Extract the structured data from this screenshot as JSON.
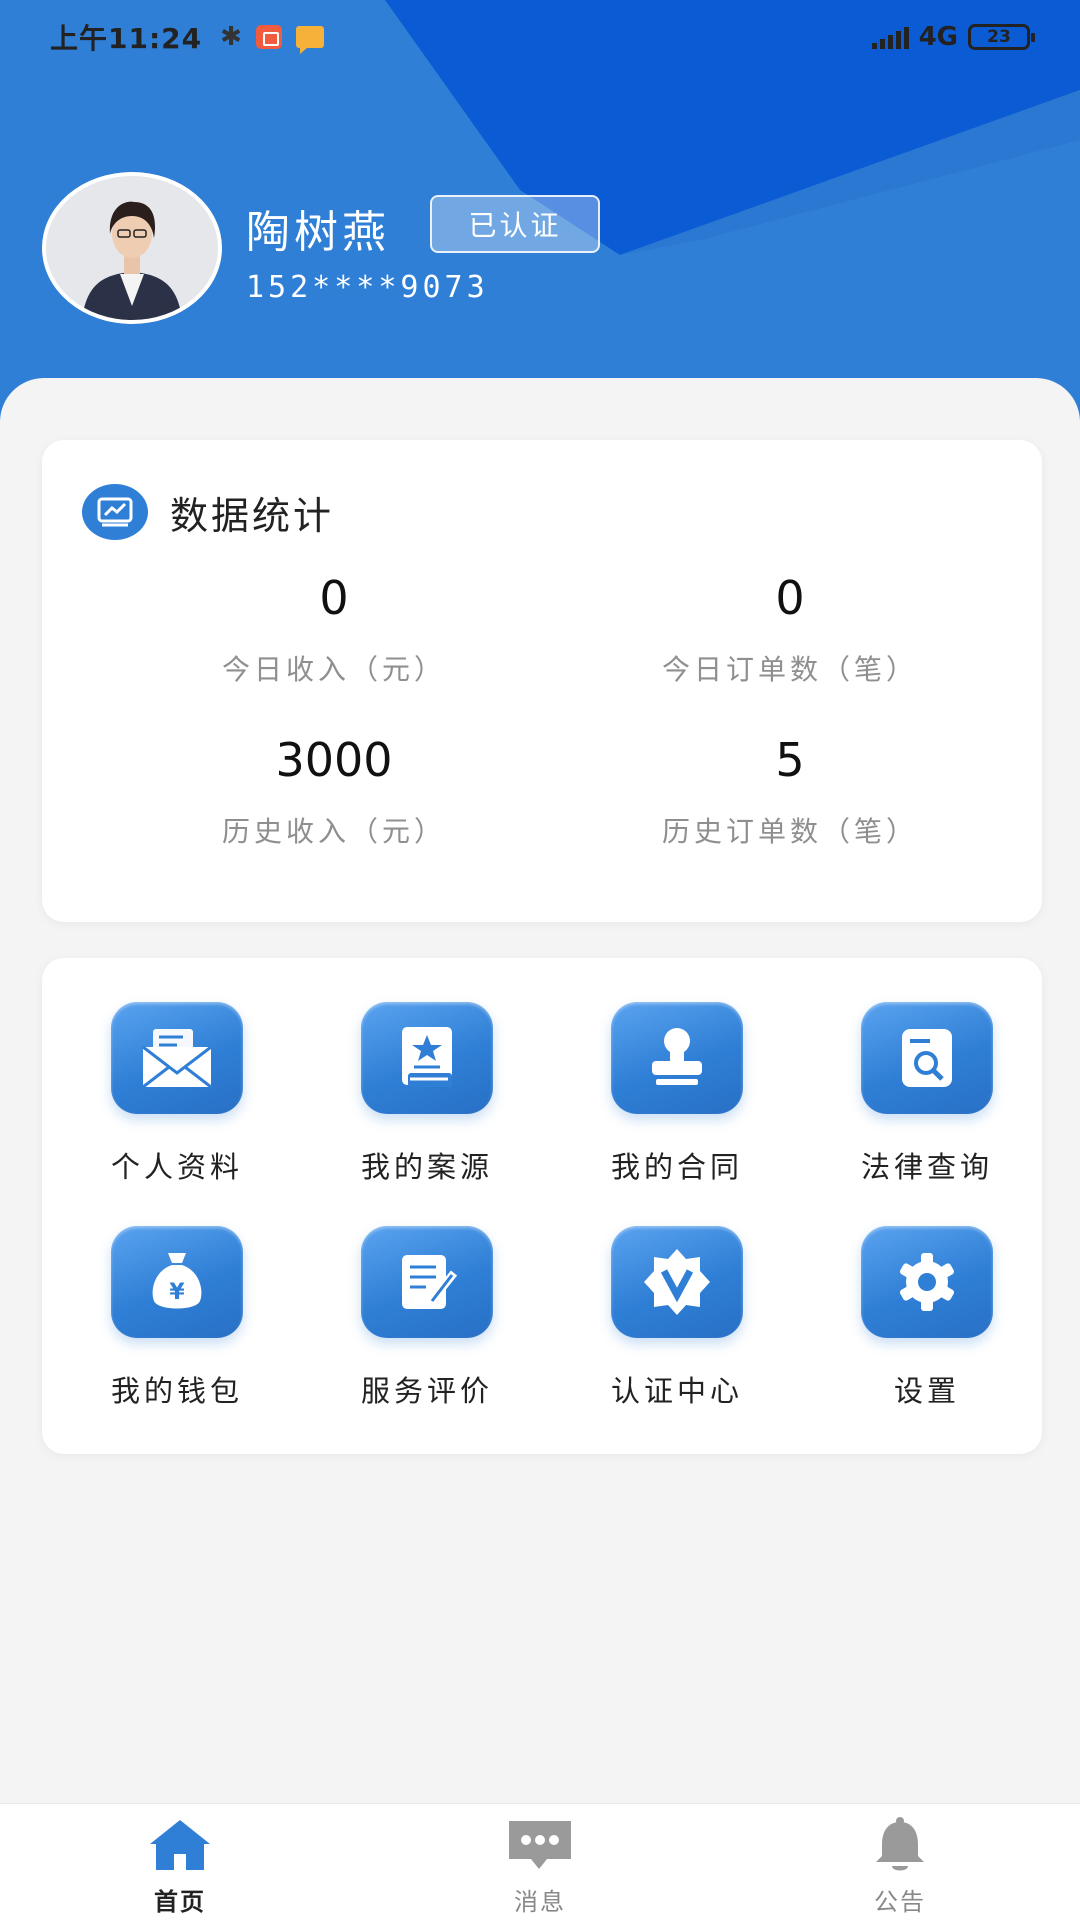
{
  "status_bar": {
    "time": "上午11:24",
    "network": "4G",
    "battery": "23"
  },
  "profile": {
    "name": "陶树燕",
    "verified_label": "已认证",
    "phone": "152****9073"
  },
  "stats": {
    "title": "数据统计",
    "items": [
      {
        "value": "0",
        "label": "今日收入（元）"
      },
      {
        "value": "0",
        "label": "今日订单数（笔）"
      },
      {
        "value": "3000",
        "label": "历史收入（元）"
      },
      {
        "value": "5",
        "label": "历史订单数（笔）"
      }
    ]
  },
  "menu": {
    "items": [
      {
        "label": "个人资料",
        "icon": "mail-icon"
      },
      {
        "label": "我的案源",
        "icon": "book-star-icon"
      },
      {
        "label": "我的合同",
        "icon": "stamp-icon"
      },
      {
        "label": "法律查询",
        "icon": "doc-search-icon"
      },
      {
        "label": "我的钱包",
        "icon": "money-bag-icon"
      },
      {
        "label": "服务评价",
        "icon": "edit-doc-icon"
      },
      {
        "label": "认证中心",
        "icon": "verify-badge-icon"
      },
      {
        "label": "设置",
        "icon": "gear-icon"
      }
    ]
  },
  "tabs": [
    {
      "label": "首页",
      "icon": "home-icon",
      "active": true
    },
    {
      "label": "消息",
      "icon": "chat-icon",
      "active": false
    },
    {
      "label": "公告",
      "icon": "bell-icon",
      "active": false
    }
  ],
  "colors": {
    "primary": "#2f7fd6",
    "header_dark": "#0b5bd4",
    "background": "#f4f4f5"
  }
}
